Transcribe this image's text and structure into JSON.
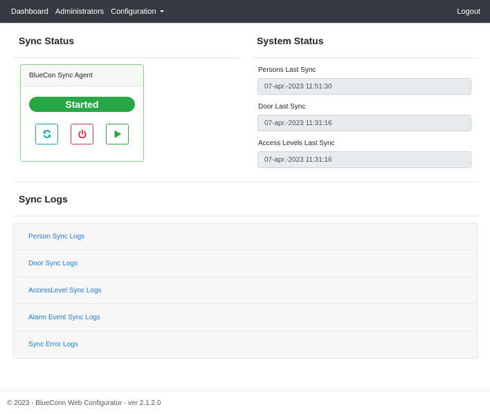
{
  "navbar": {
    "links": [
      {
        "label": "Dashboard"
      },
      {
        "label": "Administrators"
      },
      {
        "label": "Configuration",
        "has_dropdown": true
      }
    ],
    "logout_label": "Logout"
  },
  "sync_status": {
    "title": "Sync Status",
    "agent": {
      "name": "BlueCon Sync Agent",
      "status": "Started",
      "status_color": "#28a745",
      "buttons": [
        {
          "icon": "refresh-icon",
          "color": "#17a2b8"
        },
        {
          "icon": "power-icon",
          "color": "#dc3545"
        },
        {
          "icon": "play-icon",
          "color": "#28a745"
        }
      ]
    }
  },
  "system_status": {
    "title": "System Status",
    "fields": [
      {
        "label": "Persons Last Sync",
        "value": "07-apr.-2023 11:51:30"
      },
      {
        "label": "Door Last Sync",
        "value": "07-apr.-2023 11:31:16"
      },
      {
        "label": "Access Levels Last Sync",
        "value": "07-apr.-2023 11:31:16"
      }
    ]
  },
  "sync_logs": {
    "title": "Sync Logs",
    "items": [
      {
        "label": "Person Sync Logs"
      },
      {
        "label": "Door Sync Logs"
      },
      {
        "label": "AccessLevel Sync Logs"
      },
      {
        "label": "Alarm Event Sync Logs"
      },
      {
        "label": "Sync Error Logs"
      }
    ]
  },
  "footer": {
    "text": "© 2023 - BlueConn Web Configurator - ver 2.1.2.0"
  }
}
